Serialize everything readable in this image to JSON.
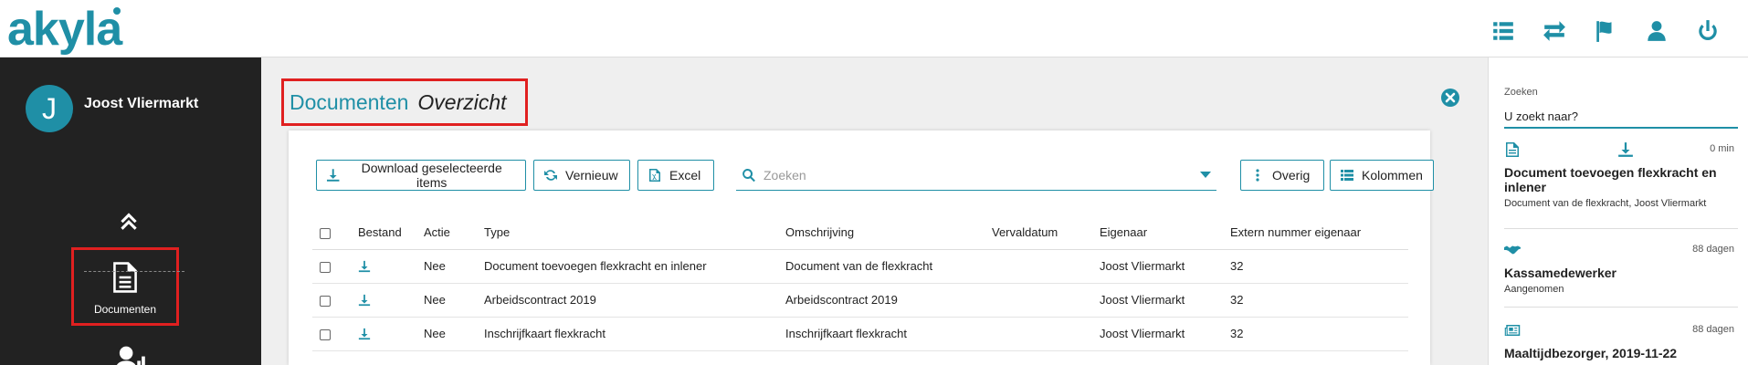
{
  "header": {
    "logo": "akyla",
    "icons": [
      "list-icon",
      "exchange-icon",
      "flag-icon",
      "user-icon",
      "power-icon"
    ]
  },
  "sidebar": {
    "avatar_letter": "J",
    "user_name": "Joost Vliermarkt",
    "nav_documents_label": "Documenten"
  },
  "page": {
    "title": "Documenten",
    "subtitle": "Overzicht"
  },
  "toolbar": {
    "download_label": "Download geselecteerde items",
    "refresh_label": "Vernieuw",
    "excel_label": "Excel",
    "search_placeholder": "Zoeken",
    "overig_label": "Overig",
    "kolommen_label": "Kolommen"
  },
  "table": {
    "columns": [
      "Bestand",
      "Actie",
      "Type",
      "Omschrijving",
      "Vervaldatum",
      "Eigenaar",
      "Extern nummer eigenaar"
    ],
    "rows": [
      {
        "actie": "Nee",
        "type": "Document toevoegen flexkracht en inlener",
        "omschrijving": "Document van de flexkracht",
        "vervaldatum": "",
        "eigenaar": "Joost Vliermarkt",
        "extern": "32"
      },
      {
        "actie": "Nee",
        "type": "Arbeidscontract 2019",
        "omschrijving": "Arbeidscontract 2019",
        "vervaldatum": "",
        "eigenaar": "Joost Vliermarkt",
        "extern": "32"
      },
      {
        "actie": "Nee",
        "type": "Inschrijfkaart flexkracht",
        "omschrijving": "Inschrijfkaart flexkracht",
        "vervaldatum": "",
        "eigenaar": "Joost Vliermarkt",
        "extern": "32"
      }
    ]
  },
  "right_panel": {
    "search_label": "Zoeken",
    "search_value": "U zoekt naar?",
    "feed": [
      {
        "time": "0 min",
        "title": "Document toevoegen flexkracht en inlener",
        "sub": "Document van de flexkracht, Joost Vliermarkt"
      },
      {
        "time": "88 dagen",
        "title": "Kassamedewerker",
        "sub": "Aangenomen"
      },
      {
        "time": "88 dagen",
        "title": "Maaltijdbezorger, 2019-11-22",
        "sub": ""
      }
    ]
  },
  "colors": {
    "accent": "#1f8fa6",
    "sidebar_bg": "#222222",
    "highlight": "#e02020"
  }
}
